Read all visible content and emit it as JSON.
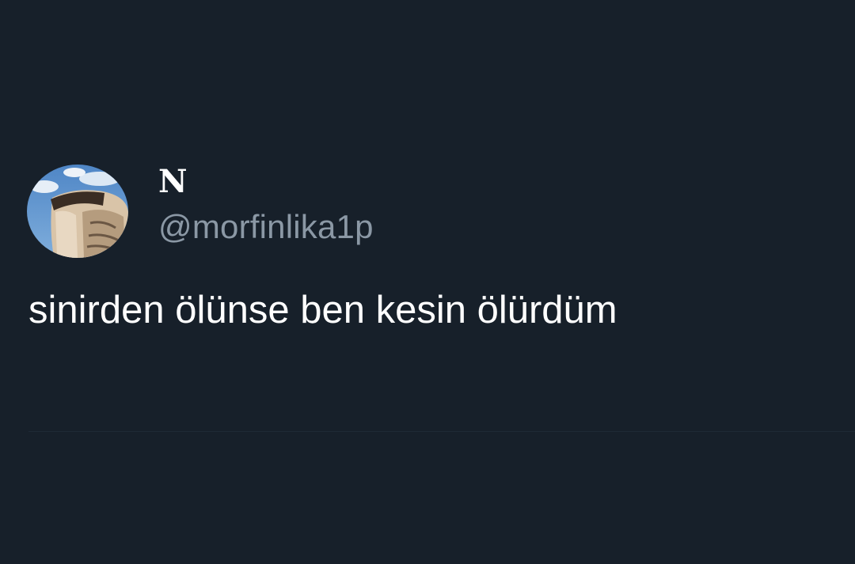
{
  "tweet": {
    "author": {
      "display_name": "N",
      "handle": "@morfinlika1p",
      "avatar_icon": "profile-photo"
    },
    "text": "sinirden ölünse ben kesin ölürdüm"
  },
  "colors": {
    "background": "#17202a",
    "text_primary": "#ffffff",
    "text_secondary": "#8b98a5"
  }
}
